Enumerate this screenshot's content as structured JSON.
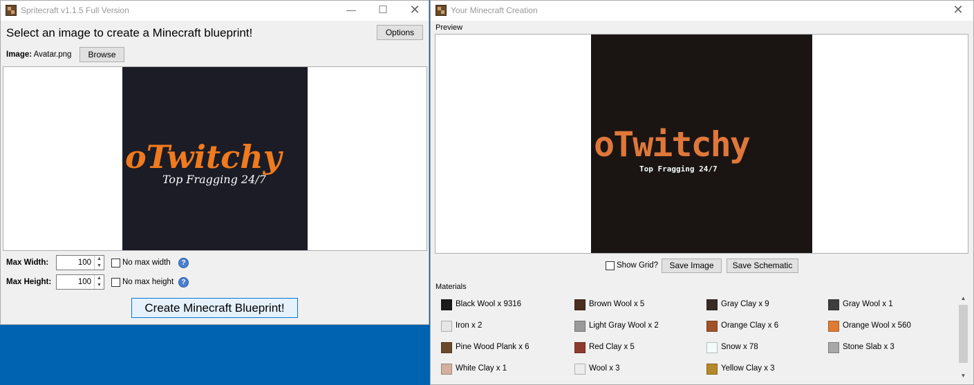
{
  "left_window": {
    "title": "Spritecraft v1.1.5 Full Version",
    "heading": "Select an image to create a Minecraft blueprint!",
    "options_label": "Options",
    "image_label": "Image:",
    "image_filename": "Avatar.png",
    "browse_label": "Browse",
    "source_logo": {
      "title": "oTwitchy",
      "subtitle": "Top Fragging 24/7"
    },
    "max_width_label": "Max Width:",
    "max_width_value": "100",
    "no_max_width_label": "No max width",
    "max_height_label": "Max Height:",
    "max_height_value": "100",
    "no_max_height_label": "No max height",
    "create_label": "Create Minecraft Blueprint!",
    "help_glyph": "?"
  },
  "right_window": {
    "title": "Your Minecraft Creation",
    "preview_label": "Preview",
    "preview_logo": {
      "title": "oTwitchy",
      "subtitle": "Top Fragging 24/7"
    },
    "show_grid_label": "Show Grid?",
    "save_image_label": "Save Image",
    "save_schematic_label": "Save Schematic",
    "materials_label": "Materials",
    "materials": [
      {
        "label": "Black Wool x 9316",
        "color": "#1b1b1b"
      },
      {
        "label": "Brown Wool x 5",
        "color": "#4a2e1e"
      },
      {
        "label": "Gray Clay x 9",
        "color": "#3a2a24"
      },
      {
        "label": "Gray Wool x 1",
        "color": "#3e3e3e"
      },
      {
        "label": "Iron x 2",
        "color": "#e6e6e6"
      },
      {
        "label": "Light Gray Wool x 2",
        "color": "#9a9a9a"
      },
      {
        "label": "Orange Clay x 6",
        "color": "#a0532a"
      },
      {
        "label": "Orange Wool x 560",
        "color": "#e07b35"
      },
      {
        "label": "Pine Wood Plank x 6",
        "color": "#6b4a2b"
      },
      {
        "label": "Red Clay x 5",
        "color": "#8e3b2e"
      },
      {
        "label": "Snow x 78",
        "color": "#f4fbfb"
      },
      {
        "label": "Stone Slab x 3",
        "color": "#a8a8a8"
      },
      {
        "label": "White Clay x 1",
        "color": "#d5b09f"
      },
      {
        "label": "Wool x 3",
        "color": "#ececec"
      },
      {
        "label": "Yellow Clay x 3",
        "color": "#b5892a"
      }
    ]
  },
  "colors": {
    "desktop": "#0063b1",
    "logo_orange": "#f07a1e",
    "logo_dark": "#1b1c25"
  }
}
